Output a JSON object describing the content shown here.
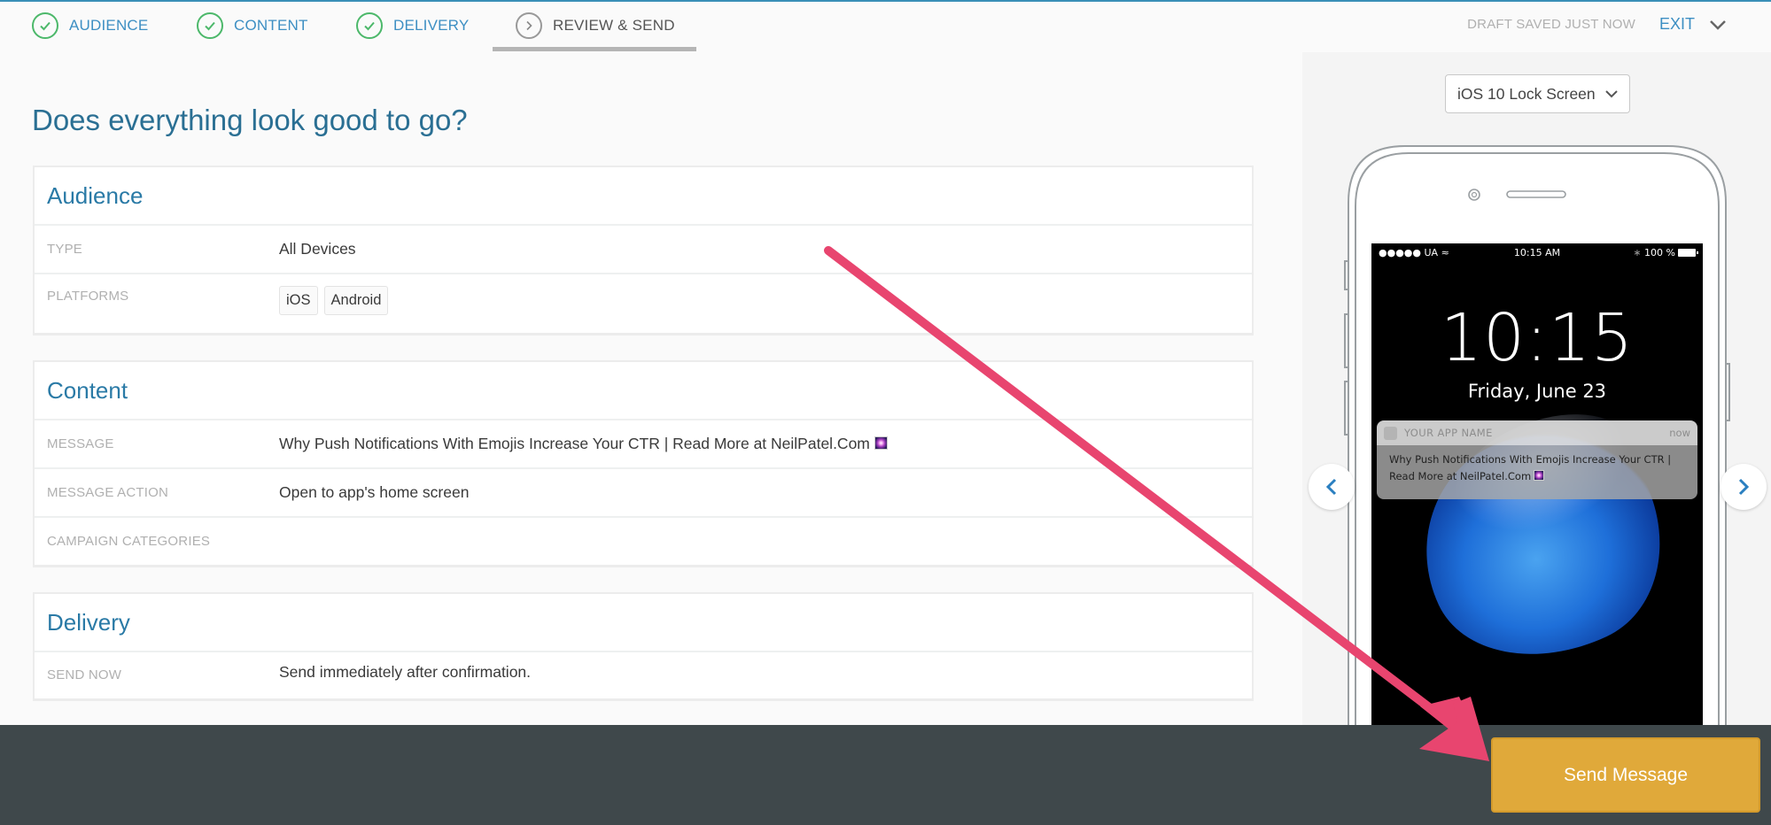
{
  "stepper": {
    "steps": [
      {
        "label": "AUDIENCE",
        "status": "complete",
        "icon": "check-icon"
      },
      {
        "label": "CONTENT",
        "status": "complete",
        "icon": "check-icon"
      },
      {
        "label": "DELIVERY",
        "status": "complete",
        "icon": "check-icon"
      },
      {
        "label": "REVIEW & SEND",
        "status": "current",
        "icon": "chevron-right-icon"
      }
    ],
    "draft_status": "DRAFT SAVED JUST NOW",
    "exit_label": "EXIT",
    "menu_icon": "chevron-down-icon"
  },
  "page": {
    "title": "Does everything look good to go?"
  },
  "sections": {
    "audience": {
      "title": "Audience",
      "rows": [
        {
          "key": "TYPE",
          "value": "All Devices"
        },
        {
          "key": "PLATFORMS",
          "pills": [
            "iOS",
            "Android"
          ]
        }
      ]
    },
    "content": {
      "title": "Content",
      "rows": [
        {
          "key": "MESSAGE",
          "value": "Why Push Notifications With Emojis Increase Your CTR | Read More at NeilPatel.Com",
          "emoji": "sparkler-emoji"
        },
        {
          "key": "MESSAGE ACTION",
          "value": "Open to app's home screen"
        },
        {
          "key": "CAMPAIGN CATEGORIES",
          "value": ""
        }
      ]
    },
    "delivery": {
      "title": "Delivery",
      "rows": [
        {
          "key": "SEND NOW",
          "value": "Send immediately after confirmation."
        }
      ]
    }
  },
  "preview": {
    "device_select": "iOS 10 Lock Screen",
    "status_bar": {
      "carrier": "●●●●● UA",
      "time": "10:15 AM",
      "battery": "100 %"
    },
    "lock_time": "10:15",
    "lock_date": "Friday, June 23",
    "notification": {
      "app_name": "YOUR APP NAME",
      "time": "now",
      "body": "Why Push Notifications With Emojis Increase Your CTR | Read More at NeilPatel.Com"
    },
    "prev_icon": "chevron-left-icon",
    "next_icon": "chevron-right-icon"
  },
  "footer": {
    "send_label": "Send Message"
  },
  "colors": {
    "accent": "#3d8fc3",
    "success": "#4cb86a",
    "title": "#2a6f93",
    "footer_bg": "#3f484b",
    "send_button": "#e0a93a",
    "annotation_arrow": "#e8456f"
  }
}
